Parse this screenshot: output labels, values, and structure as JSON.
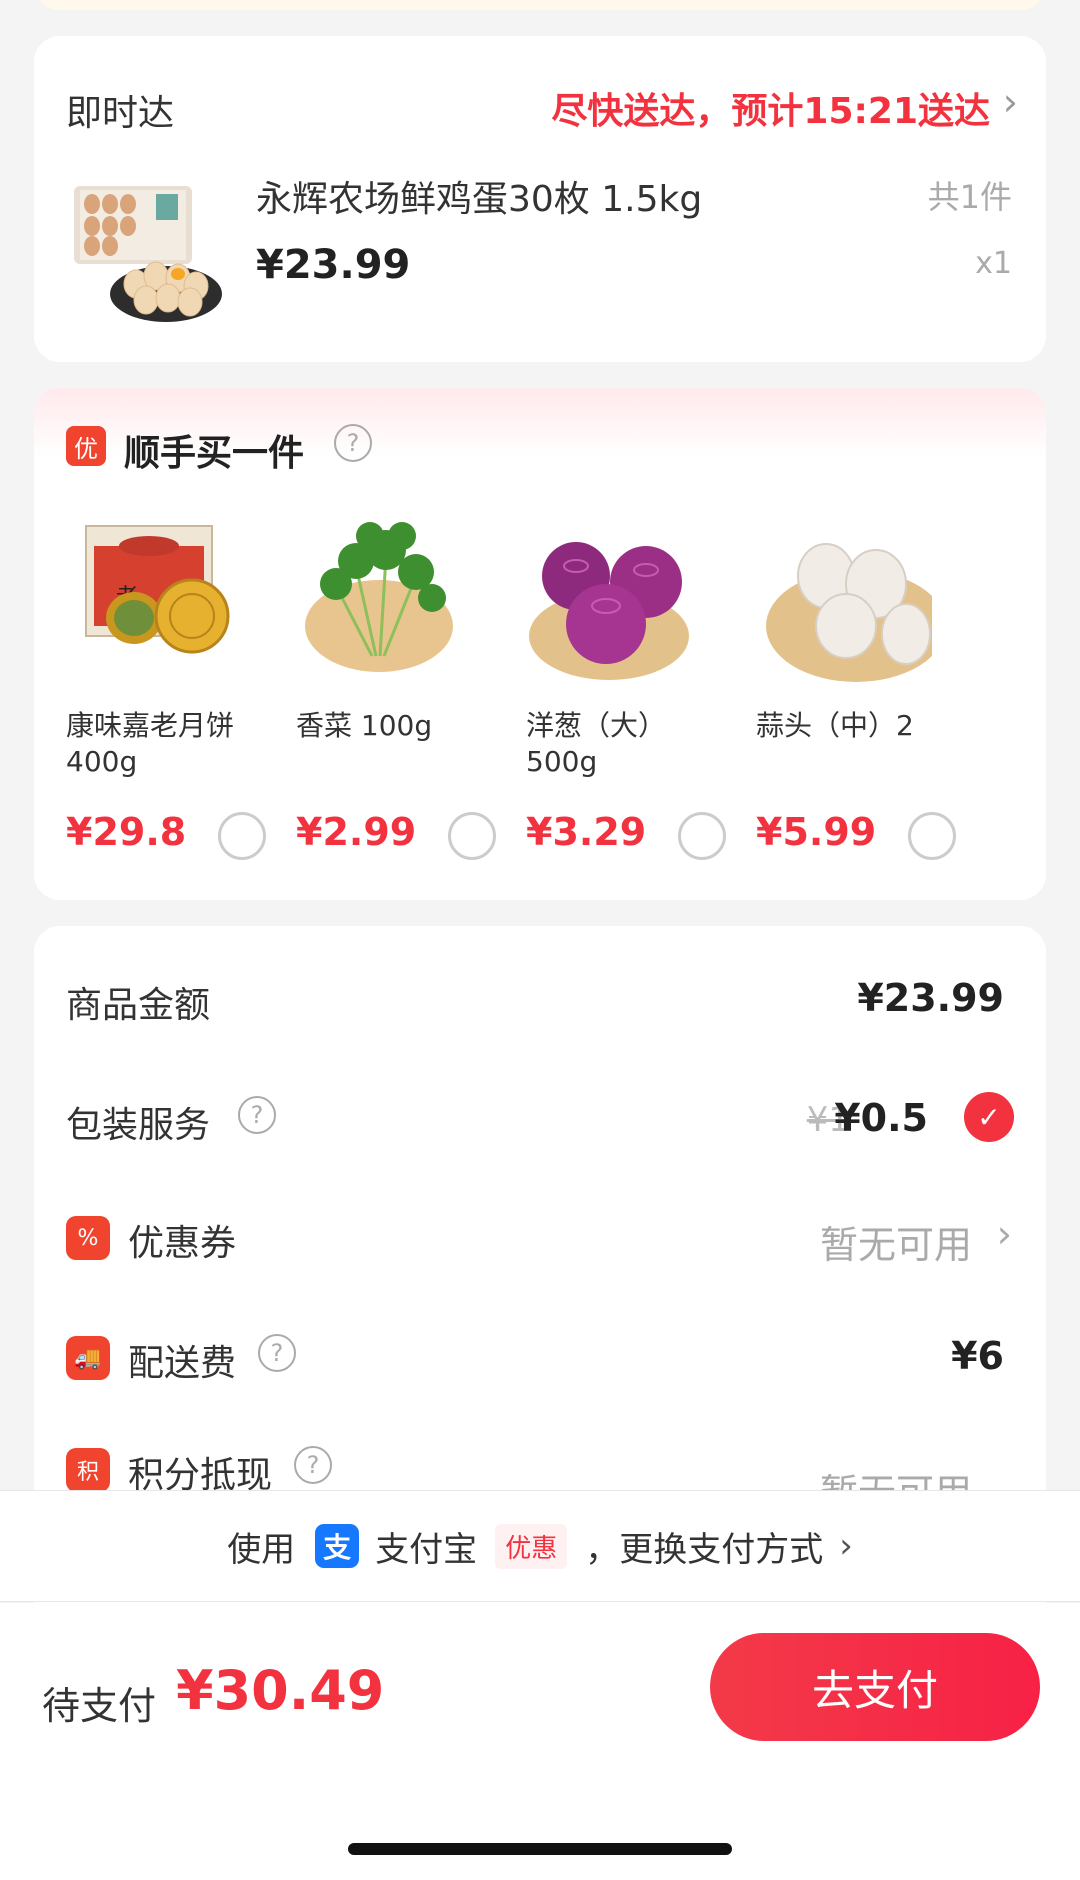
{
  "delivery": {
    "title": "即时达",
    "eta": "尽快送达，预计15:21送达",
    "product_name": "永辉农场鲜鸡蛋30枚 1.5kg",
    "item_count": "共1件",
    "price": "¥23.99",
    "qty": "x1"
  },
  "addon": {
    "badge": "优",
    "title": "顺手买一件",
    "items": [
      {
        "name": "康味嘉老月饼400g",
        "price": "¥29.8"
      },
      {
        "name": "香菜 100g",
        "price": "¥2.99"
      },
      {
        "name": "洋葱（大）500g",
        "price": "¥3.29"
      },
      {
        "name": "蒜头（中）2",
        "price": "¥5.99"
      }
    ]
  },
  "summary": {
    "goods_label": "商品金额",
    "goods_value": "¥23.99",
    "packaging_label": "包装服务",
    "packaging_old": "¥1",
    "packaging_value": "¥0.5",
    "coupon_label": "优惠券",
    "coupon_value": "暂无可用",
    "shipping_label": "配送费",
    "shipping_value": "¥6",
    "points_label": "积分抵现",
    "points_value": "暂无可用"
  },
  "payment_method": {
    "prefix": "使用",
    "name": "支付宝",
    "promo": "优惠",
    "suffix": "，更换支付方式"
  },
  "paybar": {
    "label": "待支付",
    "amount": "¥30.49",
    "button": "去支付"
  }
}
